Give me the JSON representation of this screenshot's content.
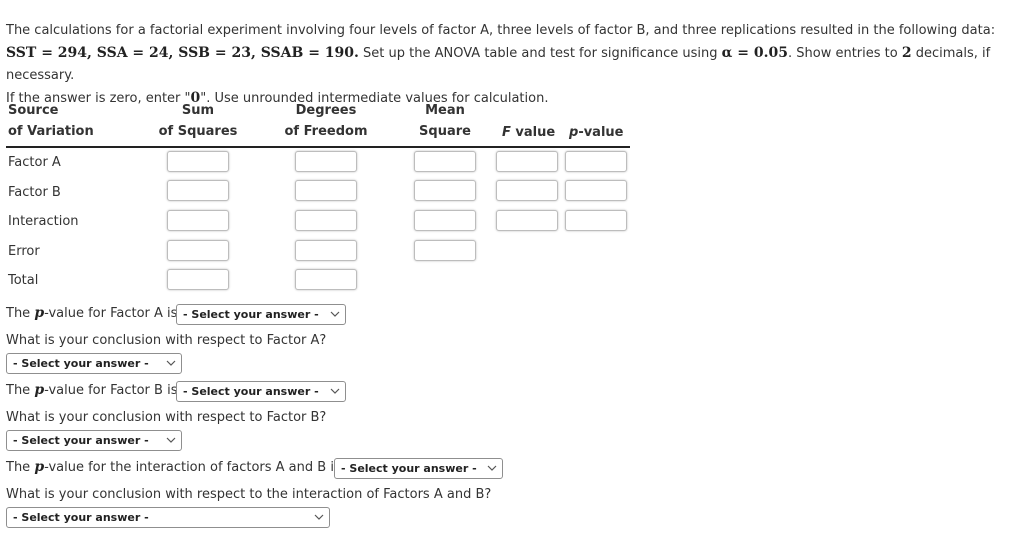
{
  "intro": {
    "line1": "The calculations for a factorial experiment involving four levels of factor A, three levels of factor B, and three replications resulted in the following data:",
    "sst": "SST = 294, SSA = 24, SSB = 23, SSAB = 190.",
    "line2_text": " Set up the ANOVA table and test for significance using ",
    "alpha": "α = 0.05",
    "line2_text2": ". Show entries to ",
    "decimals": "2",
    "line2_text3": " decimals, if necessary.",
    "line3_a": "If the answer is zero, enter \"",
    "zero": "0",
    "line3_b": "\". Use unrounded intermediate values for calculation."
  },
  "table": {
    "headers": {
      "source_1": "Source",
      "source_2": "of Variation",
      "ss_1": "Sum",
      "ss_2": "of Squares",
      "df_1": "Degrees",
      "df_2": "of Freedom",
      "ms_1": "Mean",
      "ms_2": "Square",
      "f_italic": "F",
      "f_rest": " value",
      "p_italic": "p",
      "p_rest": "-value"
    },
    "rows": [
      {
        "label": "Factor A",
        "ss": "",
        "df": "",
        "ms": "",
        "f": "",
        "p": ""
      },
      {
        "label": "Factor B",
        "ss": "",
        "df": "",
        "ms": "",
        "f": "",
        "p": ""
      },
      {
        "label": "Interaction",
        "ss": "",
        "df": "",
        "ms": "",
        "f": "",
        "p": ""
      },
      {
        "label": "Error",
        "ss": "",
        "df": "",
        "ms": ""
      },
      {
        "label": "Total",
        "ss": "",
        "df": ""
      }
    ]
  },
  "questions": {
    "pA_prefix": "The ",
    "p_symbol": "p",
    "pA_suffix": "-value for Factor A is",
    "concA": "What is your conclusion with respect to Factor A?",
    "pB_suffix": "-value for Factor B is",
    "concB": "What is your conclusion with respect to Factor B?",
    "pAB_suffix": "-value for the interaction of factors A and B is",
    "concAB": "What is your conclusion with respect to the interaction of Factors A and B?",
    "select_placeholder": "- Select your answer -"
  }
}
